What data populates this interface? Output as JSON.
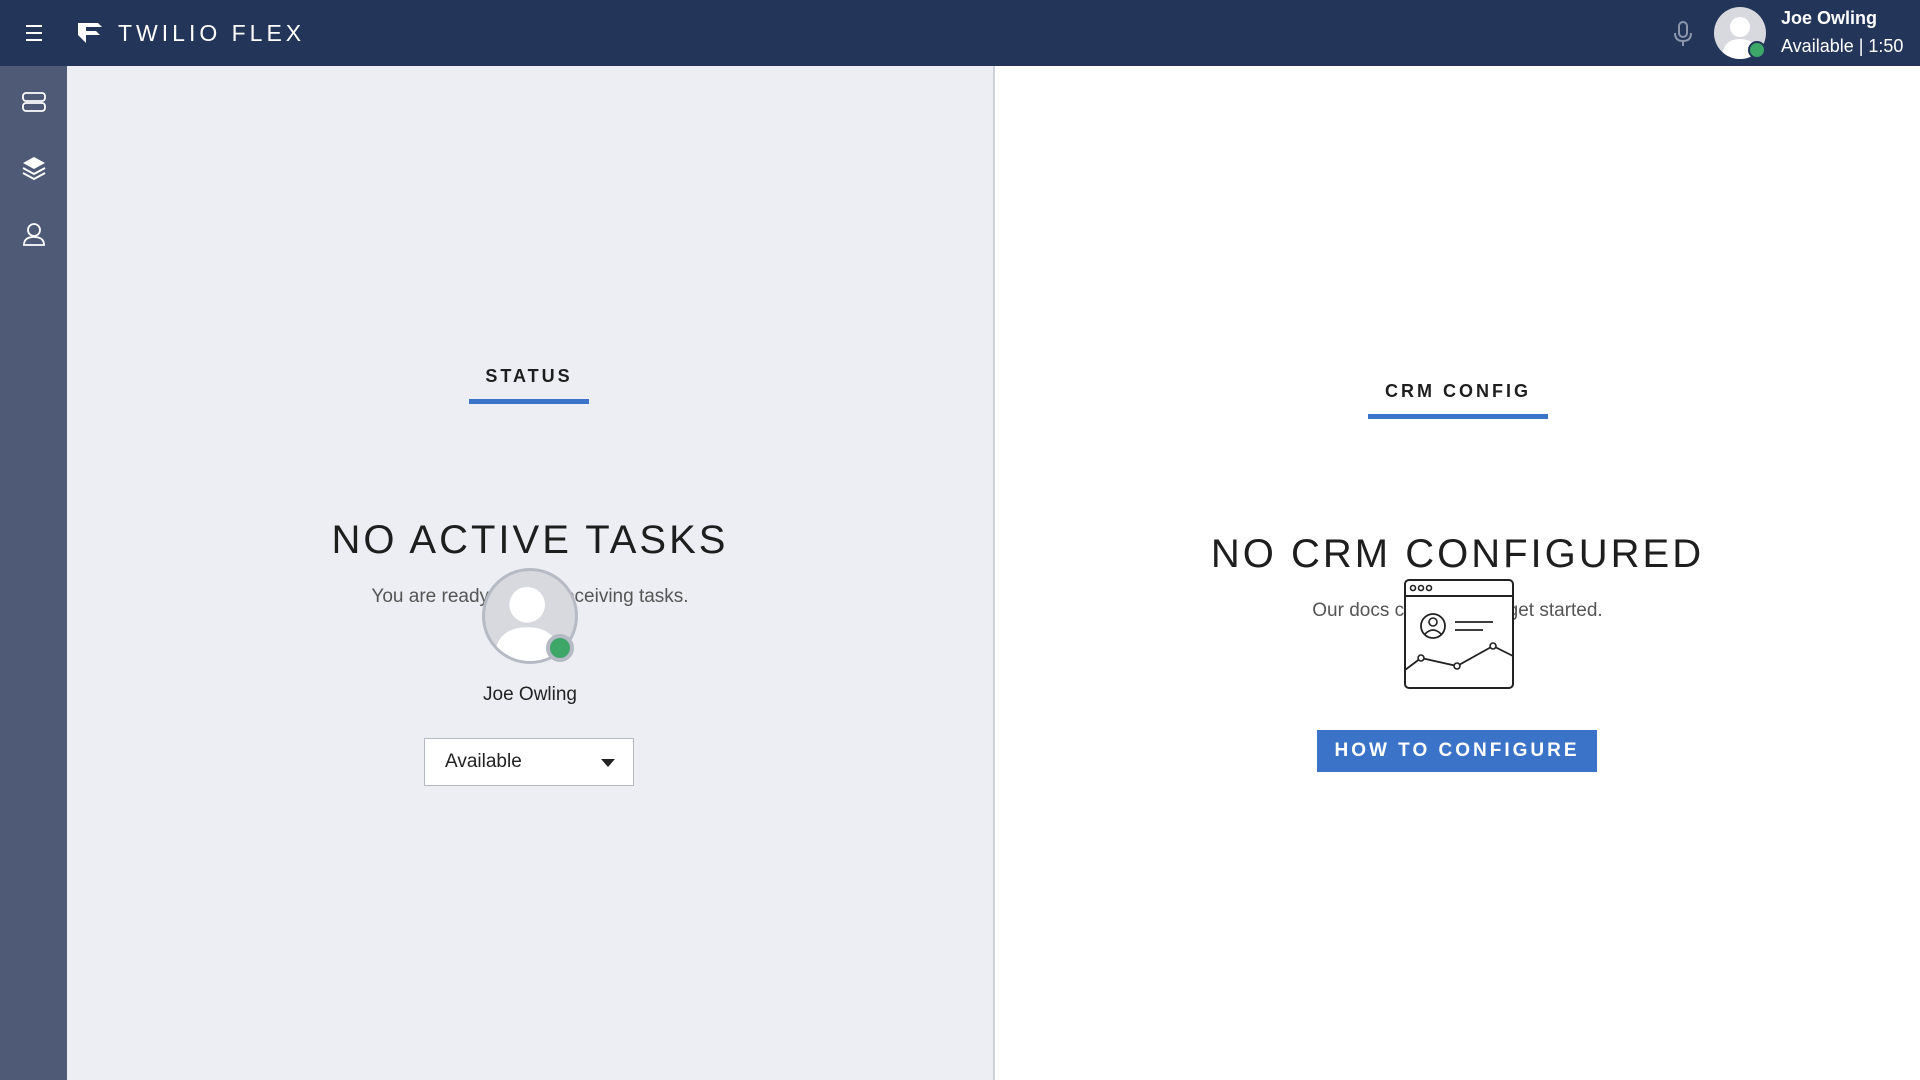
{
  "header": {
    "app_title": "TWILIO FLEX",
    "user_name": "Joe Owling",
    "user_status": "Available | 1:50",
    "icons": [
      "hamburger-menu-icon",
      "twilio-flex-logo",
      "microphone-icon",
      "user-avatar"
    ]
  },
  "sidebar": {
    "items": [
      {
        "name": "agent-desktop",
        "icon": "server-stack-icon"
      },
      {
        "name": "queues",
        "icon": "layers-icon"
      },
      {
        "name": "teams",
        "icon": "users-icon"
      }
    ]
  },
  "status_panel": {
    "tab_label": "STATUS",
    "title": "NO ACTIVE TASKS",
    "subtitle": "You are ready to start receiving tasks.",
    "agent_name": "Joe Owling",
    "activity_value": "Available"
  },
  "crm_panel": {
    "tab_label": "CRM CONFIG",
    "title": "NO CRM CONFIGURED",
    "subtitle": "Our docs can help you get started.",
    "button_label": "HOW TO CONFIGURE"
  },
  "colors": {
    "header_bg": "#233659",
    "sidebar_bg": "#4e5a76",
    "accent": "#3a73c7",
    "available": "#3ca769"
  }
}
